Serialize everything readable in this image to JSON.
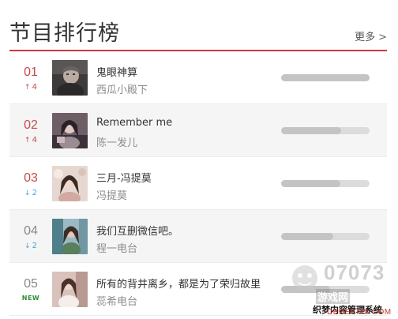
{
  "header": {
    "title": "节目排行榜",
    "more_label": "更多",
    "more_chevron": ">"
  },
  "items": [
    {
      "rank": "01",
      "trend": "up",
      "trend_arrow": "↑",
      "trend_value": "4",
      "title": "鬼眼神算",
      "artist": "西瓜小殿下",
      "popularity": 1.0
    },
    {
      "rank": "02",
      "trend": "up",
      "trend_arrow": "↑",
      "trend_value": "4",
      "title": "Remember me",
      "artist": "陈一发儿",
      "popularity": 0.68
    },
    {
      "rank": "03",
      "trend": "down",
      "trend_arrow": "↓",
      "trend_value": "2",
      "title": "三月-冯提莫",
      "artist": "冯提莫",
      "popularity": 0.67
    },
    {
      "rank": "04",
      "trend": "down",
      "trend_arrow": "↓",
      "trend_value": "2",
      "title": "我们互删微信吧。",
      "artist": "程一电台",
      "popularity": 0.59
    },
    {
      "rank": "05",
      "trend": "new",
      "trend_arrow": "",
      "trend_value": "NEW",
      "title": "所有的背井离乡，都是为了荣归故里",
      "artist": "蕊希电台",
      "popularity": 0.55
    }
  ],
  "colors": {
    "accent": "#c83a3a",
    "rank_top": "#c84a4a",
    "rank_rest": "#888888",
    "trend_up": "#c84a4a",
    "trend_down": "#4aa3d8",
    "trend_new": "#2e8b3a",
    "bar_track": "#dcdcdc",
    "bar_fill": "#c4c4c4"
  },
  "watermark": {
    "brand": "07073",
    "subtitle": "游戏网",
    "line": "织梦内容管理系统",
    "url": "DEDECMS.COM"
  }
}
